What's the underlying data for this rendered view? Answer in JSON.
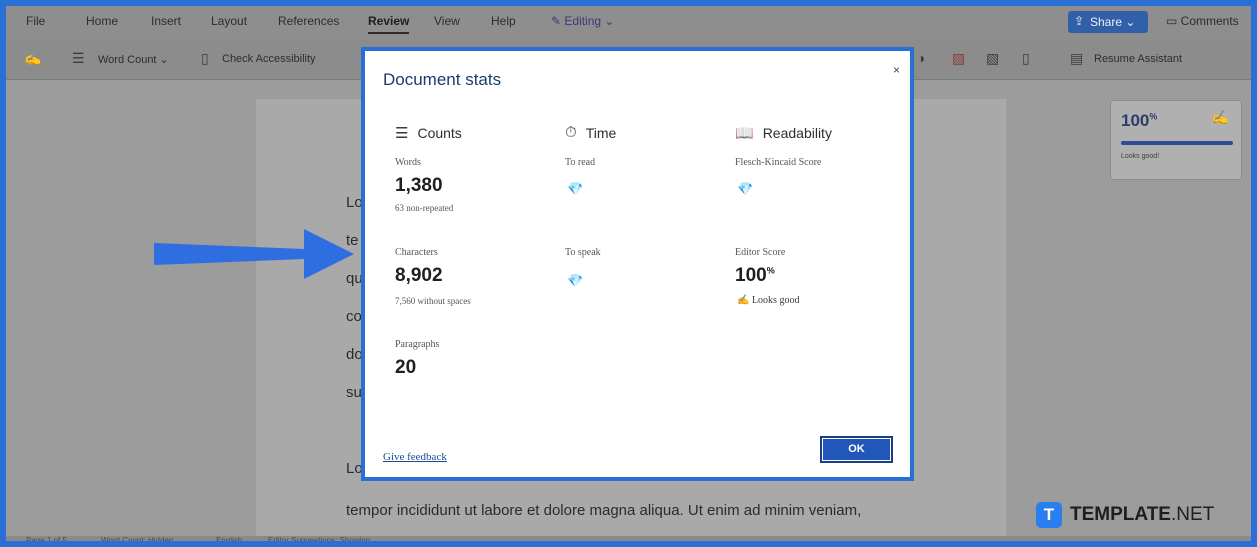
{
  "menubar": {
    "items": [
      "File",
      "Home",
      "Insert",
      "Layout",
      "References",
      "Review",
      "View",
      "Help"
    ],
    "active": "Review",
    "editing_label": "Editing",
    "share_label": "Share",
    "comments_label": "Comments"
  },
  "toolbar": {
    "word_count_label": "Word Count",
    "check_accessibility_label": "Check Accessibility",
    "resume_assistant_label": "Resume Assistant"
  },
  "document": {
    "lines": [
      "Lo",
      "te",
      "qu",
      "co",
      "do",
      "su",
      "Lo"
    ],
    "bottom_line": "tempor incididunt ut labore et dolore magna aliqua. Ut enim ad minim veniam,"
  },
  "editor_panel": {
    "score": "100",
    "score_suffix": "%",
    "label": "Looks good!"
  },
  "status_bar": {
    "items": [
      "Page 1 of 5",
      "Word Count: Hidden",
      "English",
      "Editor Suggestions: Showing"
    ]
  },
  "dialog": {
    "title": "Document stats",
    "close_glyph": "×",
    "columns": {
      "counts": "Counts",
      "time": "Time",
      "readability": "Readability"
    },
    "words": {
      "label": "Words",
      "value": "1,380",
      "sub": "63 non-repeated"
    },
    "characters": {
      "label": "Characters",
      "value": "8,902",
      "sub": "7,560 without spaces"
    },
    "paragraphs": {
      "label": "Paragraphs",
      "value": "20"
    },
    "to_read": {
      "label": "To read"
    },
    "to_speak": {
      "label": "To speak"
    },
    "flesch": {
      "label": "Flesch-Kincaid Score"
    },
    "editor_score": {
      "label": "Editor Score",
      "value": "100",
      "suffix": "%",
      "looks": "Looks good"
    },
    "feedback_label": "Give feedback",
    "ok_label": "OK"
  },
  "watermark": {
    "badge": "T",
    "text_bold": "TEMPLATE",
    "text_light": ".NET"
  },
  "colors": {
    "frame": "#2a6fd6",
    "primary_button": "#2157b8",
    "dialog_title": "#1a3b6e",
    "arrow": "#2f6ee0"
  },
  "icons": {
    "counts": "lines-icon",
    "time": "stopwatch-icon",
    "readability": "book-icon",
    "premium": "diamond-icon",
    "editor": "pen-icon"
  }
}
